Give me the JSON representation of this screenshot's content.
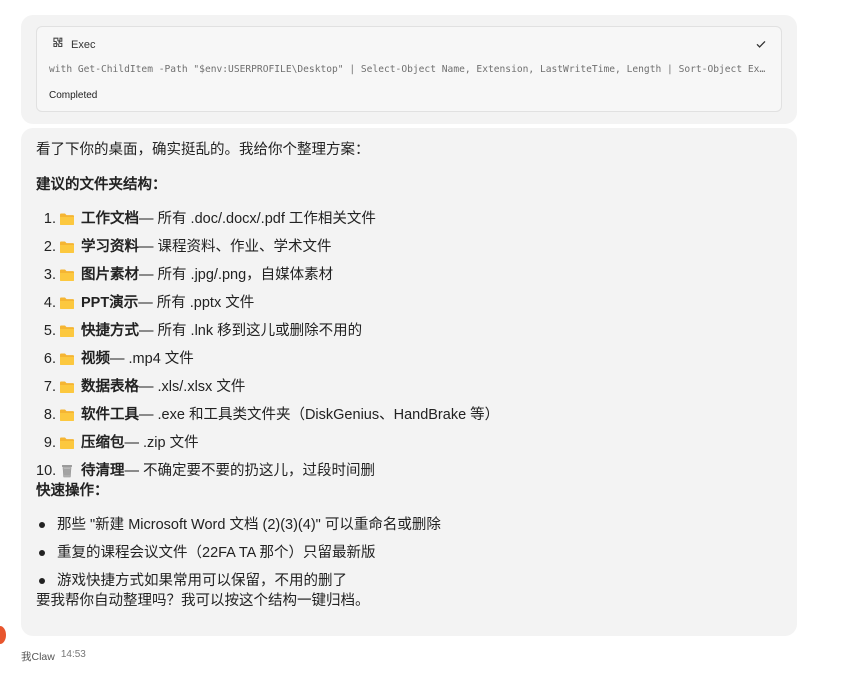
{
  "exec": {
    "title": "Exec",
    "icon": "plugin-icon",
    "command": "with Get-ChildItem -Path \"$env:USERPROFILE\\Desktop\" | Select-Object Name, Extension, LastWriteTime, Length | Sort-Object Ext…",
    "status": "Completed"
  },
  "message": {
    "intro": "看了下你的桌面，确实挺乱的。我给你个整理方案：",
    "folders_heading": "建议的文件夹结构：",
    "folders": [
      {
        "num": "1.",
        "icon": "folder-icon",
        "name": "工作文档",
        "desc": " — 所有 .doc/.docx/.pdf 工作相关文件"
      },
      {
        "num": "2.",
        "icon": "folder-icon",
        "name": "学习资料",
        "desc": " — 课程资料、作业、学术文件"
      },
      {
        "num": "3.",
        "icon": "folder-icon",
        "name": "图片素材",
        "desc": " — 所有 .jpg/.png，自媒体素材"
      },
      {
        "num": "4.",
        "icon": "folder-icon",
        "name": "PPT演示",
        "desc": " — 所有 .pptx 文件"
      },
      {
        "num": "5.",
        "icon": "folder-icon",
        "name": "快捷方式",
        "desc": " — 所有 .lnk 移到这儿或删除不用的"
      },
      {
        "num": "6.",
        "icon": "folder-icon",
        "name": "视频",
        "desc": " — .mp4 文件"
      },
      {
        "num": "7.",
        "icon": "folder-icon",
        "name": "数据表格",
        "desc": " — .xls/.xlsx 文件"
      },
      {
        "num": "8.",
        "icon": "folder-icon",
        "name": "软件工具",
        "desc": " — .exe 和工具类文件夹（DiskGenius、HandBrake 等）"
      },
      {
        "num": "9.",
        "icon": "folder-icon",
        "name": "压缩包",
        "desc": " — .zip 文件"
      },
      {
        "num": "10.",
        "icon": "trash-icon",
        "name": "待清理",
        "desc": " — 不确定要不要的扔这儿，过段时间删"
      }
    ],
    "ops_heading": "快速操作：",
    "ops": [
      "那些 \"新建 Microsoft Word 文档 (2)(3)(4)\" 可以重命名或删除",
      "重复的课程会议文件（22FA TA 那个）只留最新版",
      "游戏快捷方式如果常用可以保留，不用的删了"
    ],
    "outro": "要我帮你自动整理吗？我可以按这个结构一键归档。"
  },
  "footer": {
    "sender": "我Claw",
    "time": "14:53"
  },
  "colors": {
    "folder": "#f5b533",
    "avatar": "#e8552d",
    "bubble": "#f3f3f3"
  }
}
